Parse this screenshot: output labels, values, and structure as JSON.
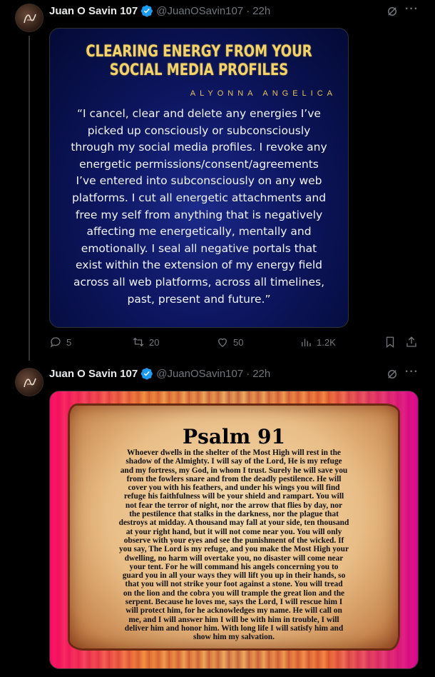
{
  "tweets": [
    {
      "author_name": "Juan O Savin 107",
      "handle": "@JuanOSavin107",
      "separator": "·",
      "time": "22h",
      "image": {
        "title_line1": "CLEARING ENERGY FROM YOUR",
        "title_line2": "SOCIAL MEDIA PROFILES",
        "author": "ALYONNA ANGELICA",
        "quote_lines": [
          "“I cancel, clear and delete any energies I’ve",
          "picked up consciously or subconsciously",
          "through my social media profiles. I revoke any",
          "energetic permissions/consent/agreements",
          "I’ve entered into subconsciously on any web",
          "platforms. I cut all energetic attachments and",
          "free my self from anything that is negatively",
          "affecting me energetically, mentally and",
          "emotionally. I seal all negative portals that",
          "exist within the extension of my energy field",
          "across all web platforms, across all timelines,",
          "past, present and future.”"
        ]
      },
      "stats": {
        "replies": "5",
        "reposts": "20",
        "likes": "50",
        "views": "1.2K"
      }
    },
    {
      "author_name": "Juan O Savin 107",
      "handle": "@JuanOSavin107",
      "separator": "·",
      "time": "22h",
      "image": {
        "title": "Psalm 91",
        "text_lines": [
          "Whoever dwells in the shelter of the Most High will rest in the",
          "shadow of the Almighty. I will say of the Lord, He is my refuge",
          "and my fortress, my God, in whom I trust. Surely he will save you",
          "from the fowlers snare and from the deadly pestilence. He will",
          "cover you with his feathers, and under his wings you will find",
          "refuge his faithfulness will be your shield and rampart. You will",
          "not fear the terror of night, nor the arrow that flies by day, nor",
          "the pestilence that stalks in the darkness, nor the plague that",
          "destroys at midday. A thousand may fall at your side, ten thousand",
          "at your right hand, but it will not come near you. You will only",
          "observe with your eyes and see the punishment of the wicked. If",
          "you say, The Lord is my refuge, and you make the Most High your",
          "dwelling, no harm will overtake you, no disaster will come near",
          "your tent. For he will command his angels concerning you to",
          "guard you in all your ways they will lift you up in their hands, so",
          "that you will not strike your foot against a stone. You will tread",
          "on the lion and the cobra you will trample the great lion and the",
          "serpent. Because he loves me, says the Lord, I will rescue him I",
          "will protect him, for he acknowledges my name. He will call on",
          "me, and I will answer him I will be with him in trouble, I will",
          "deliver him and honor him. With long life I will satisfy him and",
          "show him my salvation."
        ]
      }
    }
  ],
  "icons": {
    "verified": "verified-badge-icon",
    "grok": "grok-icon",
    "more": "more-icon",
    "reply": "reply-icon",
    "repost": "repost-icon",
    "like": "like-icon",
    "views": "views-icon",
    "bookmark": "bookmark-icon",
    "share": "share-icon"
  },
  "colors": {
    "accent": "#1d9bf0",
    "muted": "#71767b",
    "background": "#000000"
  }
}
